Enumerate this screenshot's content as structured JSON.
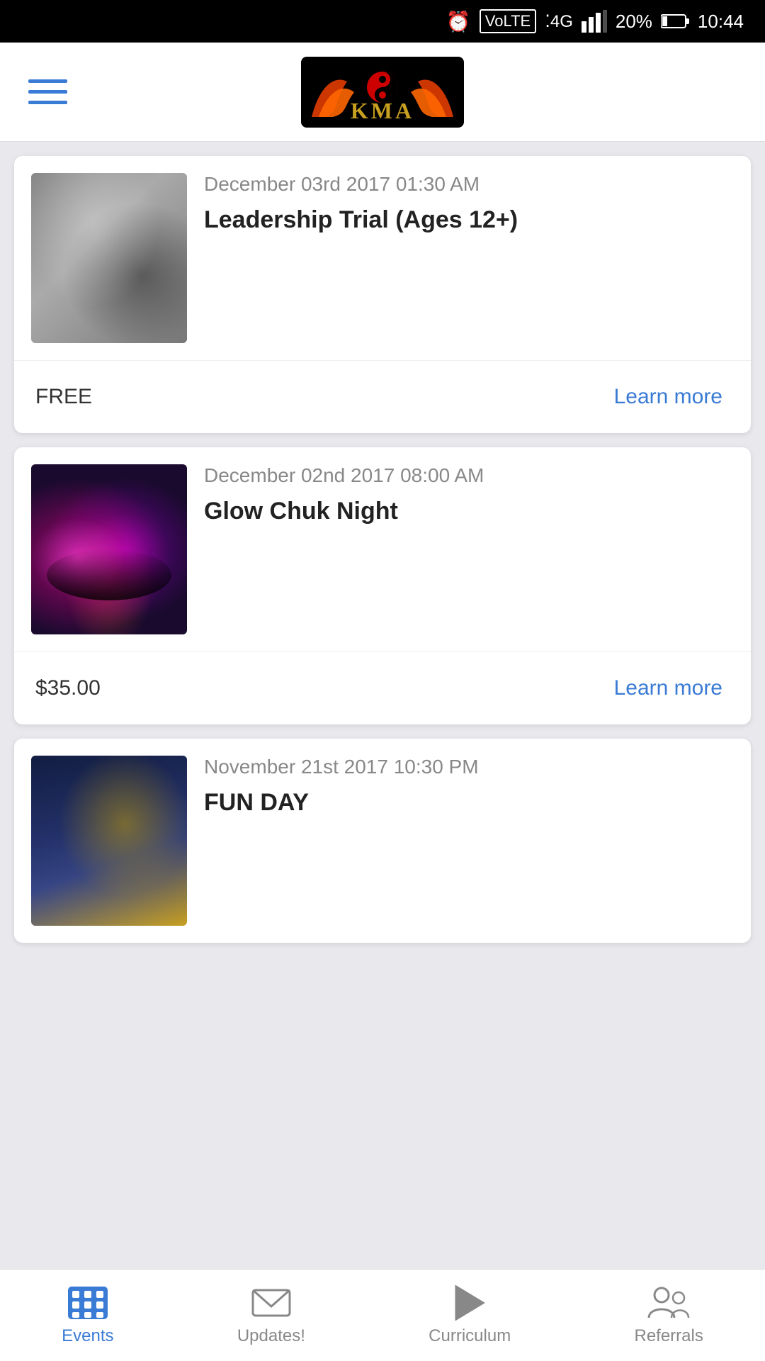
{
  "statusBar": {
    "time": "10:44",
    "battery": "20%",
    "network": "4G"
  },
  "header": {
    "logoAlt": "KMA Logo",
    "menuLabel": "Menu"
  },
  "events": [
    {
      "id": "event-1",
      "date": "December 03rd 2017 01:30 AM",
      "title": "Leadership Trial (Ages 12+)",
      "price": "FREE",
      "learnMore": "Learn more",
      "imageClass": "img-leadership"
    },
    {
      "id": "event-2",
      "date": "December 02nd 2017 08:00 AM",
      "title": "Glow Chuk Night",
      "price": "$35.00",
      "learnMore": "Learn more",
      "imageClass": "img-glowchuk"
    },
    {
      "id": "event-3",
      "date": "November 21st 2017 10:30 PM",
      "title": "FUN DAY",
      "price": "",
      "learnMore": "",
      "imageClass": "img-funday"
    }
  ],
  "bottomNav": {
    "items": [
      {
        "id": "events",
        "label": "Events",
        "active": true
      },
      {
        "id": "updates",
        "label": "Updates!",
        "active": false
      },
      {
        "id": "curriculum",
        "label": "Curriculum",
        "active": false
      },
      {
        "id": "referrals",
        "label": "Referrals",
        "active": false
      }
    ]
  }
}
